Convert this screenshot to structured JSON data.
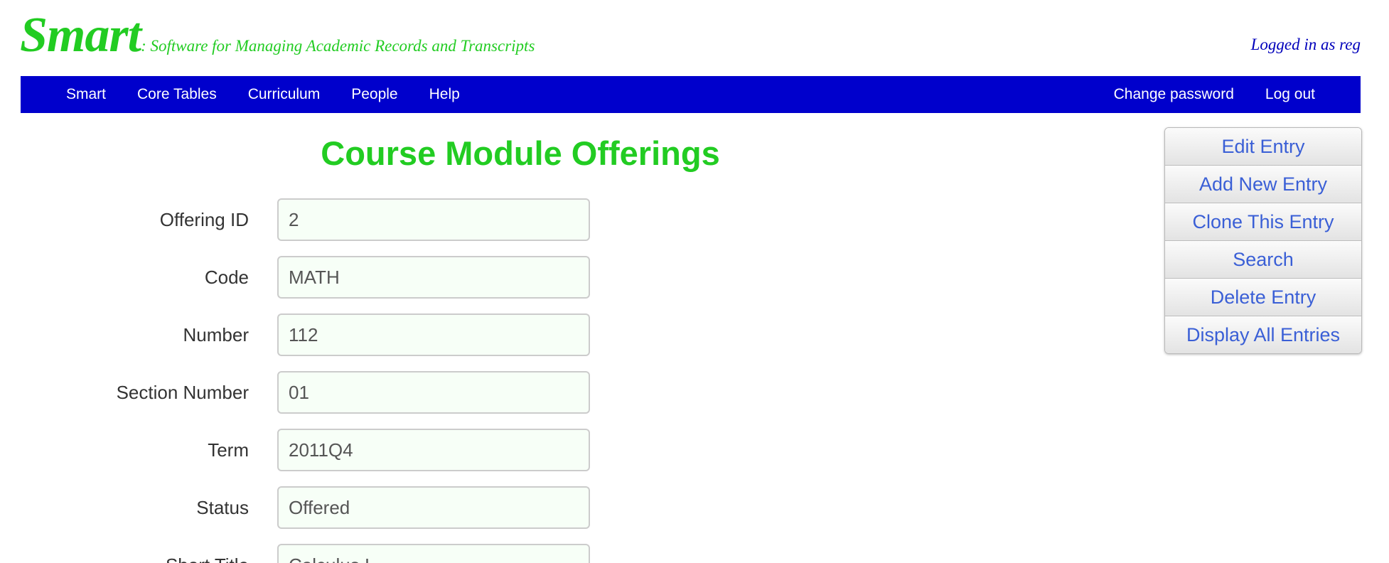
{
  "header": {
    "logo": "Smart",
    "tagline": ": Software for Managing Academic Records and Transcripts",
    "login_status": "Logged in as reg"
  },
  "nav": {
    "left": [
      {
        "label": "Smart"
      },
      {
        "label": "Core Tables"
      },
      {
        "label": "Curriculum"
      },
      {
        "label": "People"
      },
      {
        "label": "Help"
      }
    ],
    "right": [
      {
        "label": "Change password"
      },
      {
        "label": "Log out"
      }
    ]
  },
  "page": {
    "title": "Course Module Offerings"
  },
  "form": {
    "fields": [
      {
        "label": "Offering ID",
        "value": "2"
      },
      {
        "label": "Code",
        "value": "MATH"
      },
      {
        "label": "Number",
        "value": "112"
      },
      {
        "label": "Section Number",
        "value": "01"
      },
      {
        "label": "Term",
        "value": "2011Q4"
      },
      {
        "label": "Status",
        "value": "Offered"
      },
      {
        "label": "Short Title",
        "value": "Calculus I"
      }
    ]
  },
  "actions": [
    {
      "label": "Edit Entry"
    },
    {
      "label": "Add New Entry"
    },
    {
      "label": "Clone This Entry"
    },
    {
      "label": "Search"
    },
    {
      "label": "Delete Entry"
    },
    {
      "label": "Display All Entries"
    }
  ],
  "colors": {
    "brand_green": "#22cc22",
    "nav_blue": "#0000cc",
    "login_blue": "#0000bb",
    "action_text": "#3a5fd6",
    "input_background": "#f7fff7"
  }
}
